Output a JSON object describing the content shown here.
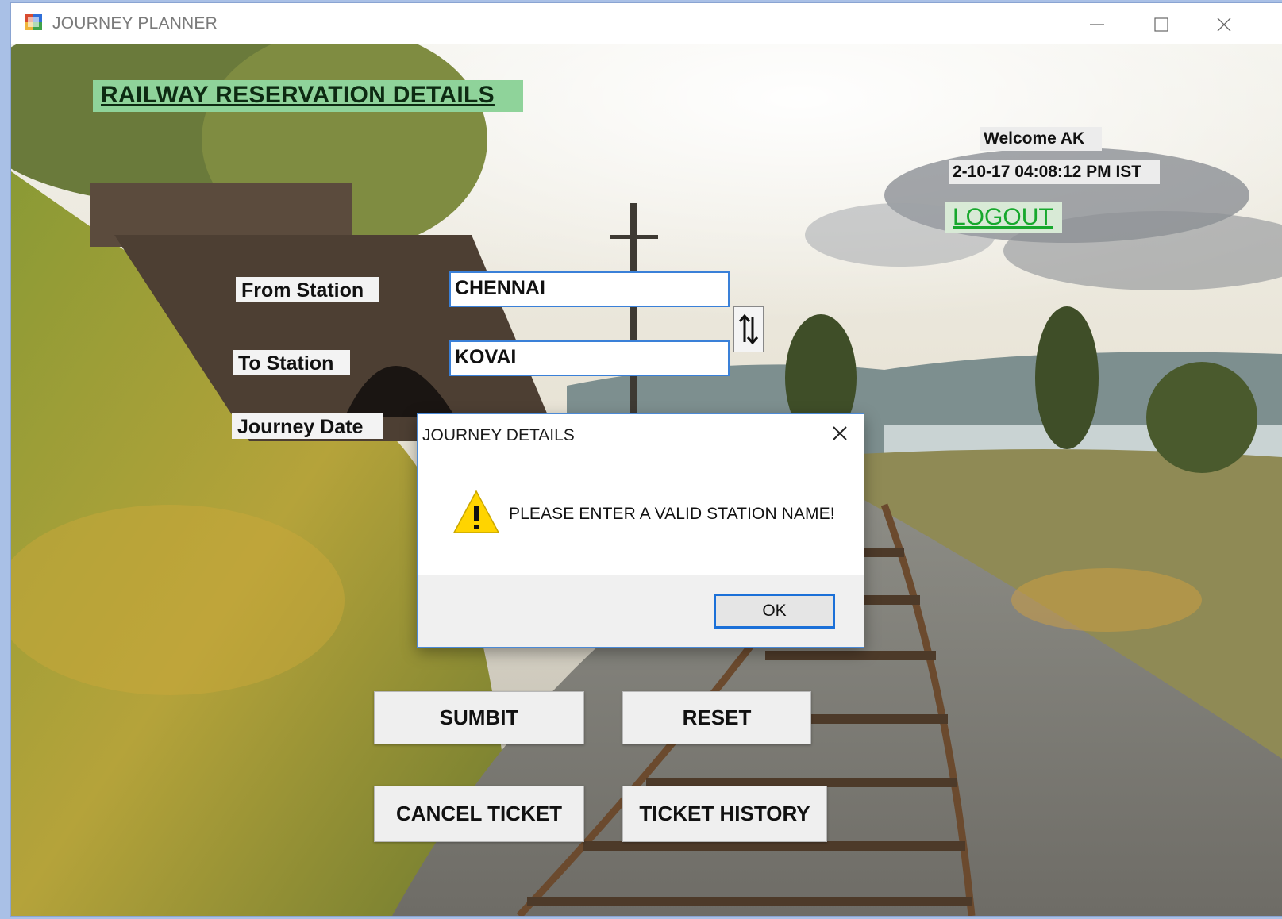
{
  "window": {
    "title": "JOURNEY PLANNER"
  },
  "form": {
    "banner": "RAILWAY RESERVATION DETAILS",
    "welcome": "Welcome AK",
    "datetime": "2-10-17 04:08:12 PM IST",
    "logout": "LOGOUT",
    "from_label": "From Station",
    "from_value": "CHENNAI",
    "to_label": "To Station",
    "to_value": "KOVAI",
    "date_label": "Journey Date",
    "swap_icon": "swap-arrows-icon"
  },
  "buttons": {
    "submit": "SUMBIT",
    "reset": "RESET",
    "cancel_ticket": "CANCEL TICKET",
    "ticket_history": "TICKET HISTORY"
  },
  "dialog": {
    "title": "JOURNEY DETAILS",
    "message": "PLEASE ENTER A VALID STATION NAME!",
    "ok": "OK",
    "icon": "warning-icon"
  },
  "colors": {
    "banner_bg": "#8fd39a",
    "logout_text": "#17a82d",
    "input_border": "#3a80d8",
    "ok_border": "#1b70d8",
    "warning_fill": "#ffd400"
  }
}
